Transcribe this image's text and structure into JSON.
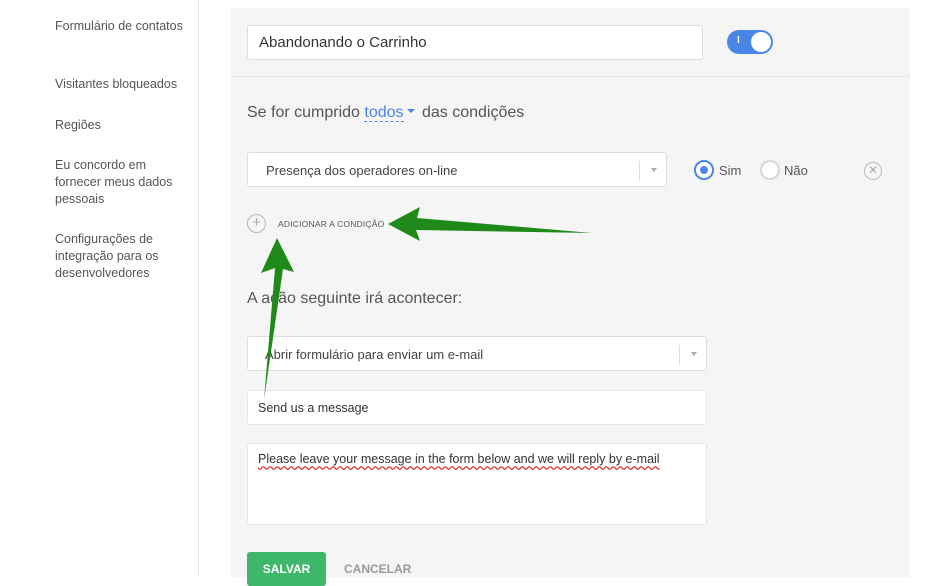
{
  "sidebar": {
    "items": [
      {
        "label": "Formulário de contatos"
      },
      {
        "label": "Visitantes bloqueados"
      },
      {
        "label": "Regiões"
      },
      {
        "label": "Eu concordo em fornecer meus dados pessoais"
      },
      {
        "label": "Configurações de integração para os desenvolvedores"
      }
    ]
  },
  "rule": {
    "name": "Abandonando o Carrinho",
    "toggle": {
      "on": true,
      "mark": "I"
    }
  },
  "conditions": {
    "prefix": "Se for cumprido",
    "mode": "todos",
    "suffix": "das condições",
    "items": [
      {
        "selected": "Presença dos operadores on-line",
        "yes_label": "Sim",
        "no_label": "Não",
        "value": "Sim"
      }
    ],
    "add_label": "ADICIONAR A CONDIÇÃO"
  },
  "action": {
    "heading": "A ação seguinte irá acontecer:",
    "selected": "Abrir formulário para enviar um e-mail",
    "title_value": "Send us a message",
    "message_value": "Please leave your message in the form below and we will reply by e-mail"
  },
  "buttons": {
    "save": "SALVAR",
    "cancel": "CANCELAR"
  },
  "colors": {
    "accent": "#4a86e8",
    "save": "#3fb76b",
    "arrow": "#1f8a1a"
  },
  "icons": [
    "plus-circle-icon",
    "close-circle-icon",
    "chevron-down-icon"
  ]
}
